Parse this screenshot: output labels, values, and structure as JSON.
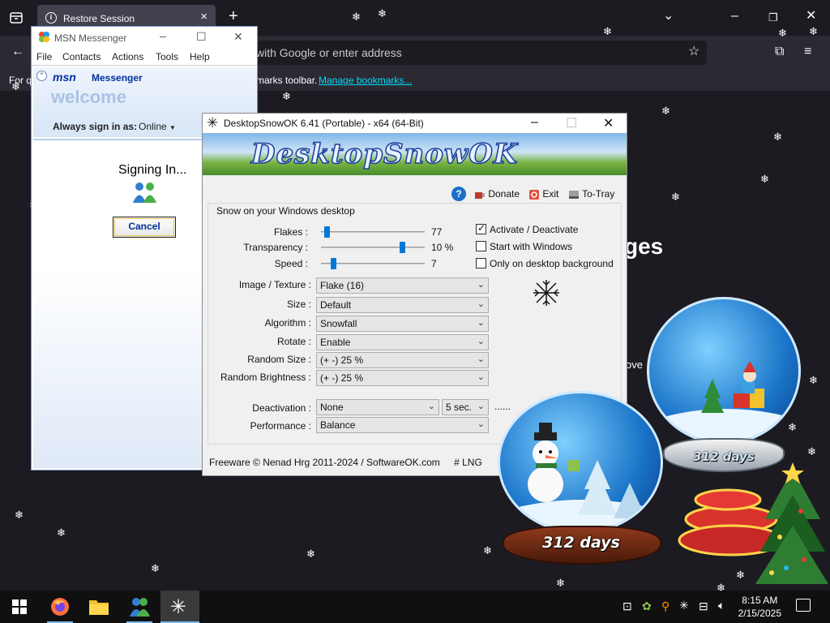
{
  "firefox": {
    "tab_title": "Restore Session",
    "url_placeholder": "with Google or enter address",
    "bookmark_prefix": "For q",
    "bookmark_text": "marks toolbar.",
    "bookmark_link": "Manage bookmarks...",
    "partial_heading": "ges",
    "partial_text": "ove"
  },
  "msn": {
    "title": "MSN Messenger",
    "menu": [
      "File",
      "Contacts",
      "Actions",
      "Tools",
      "Help"
    ],
    "brand_msn": "msn",
    "brand_messenger": "Messenger",
    "welcome": "welcome",
    "signin_label": "Always sign in as:",
    "signin_status": "Online",
    "signing_in": "Signing In...",
    "cancel": "Cancel"
  },
  "dso": {
    "title": "DesktopSnowOK 6.41 (Portable) - x64 (64-Bit)",
    "banner": "DesktopSnowOK",
    "toolbar": {
      "help": "?",
      "donate": "Donate",
      "exit": "Exit",
      "tray": "To-Tray"
    },
    "group_label": "Snow on your Windows desktop",
    "sliders": [
      {
        "label": "Flakes :",
        "value": "77",
        "level": 0.03
      },
      {
        "label": "Transparency :",
        "value": "10 %",
        "level": 0.8
      },
      {
        "label": "Speed :",
        "value": "7",
        "level": 0.1
      }
    ],
    "checkboxes": [
      {
        "label": "Activate / Deactivate",
        "checked": true
      },
      {
        "label": "Start with Windows",
        "checked": false
      },
      {
        "label": "Only on desktop background",
        "checked": false
      }
    ],
    "dropdowns": [
      {
        "label": "Image / Texture :",
        "value": "Flake (16)"
      },
      {
        "label": "Size :",
        "value": "Default"
      },
      {
        "label": "Algorithm :",
        "value": "Snowfall"
      },
      {
        "label": "Rotate :",
        "value": "Enable"
      },
      {
        "label": "Random Size :",
        "value": "(+ -) 25 %"
      },
      {
        "label": "Random Brightness :",
        "value": "(+ -) 25 %"
      }
    ],
    "deactivation": {
      "label": "Deactivation :",
      "value": "None",
      "time": "5 sec.",
      "more": "......"
    },
    "performance": {
      "label": "Performance :",
      "value": "Balance"
    },
    "footer_copyright": "Freeware © Nenad Hrg 2011-2024 / SoftwareOK.com",
    "footer_lng": "# LNG"
  },
  "globes": {
    "front_days": "312 days",
    "back_days": "312 days"
  },
  "taskbar": {
    "apps": [
      "start-icon",
      "firefox-icon",
      "file-explorer-icon",
      "msn-messenger-icon",
      "desktopsnowok-icon"
    ],
    "time": "8:15 AM",
    "date": "2/15/2025"
  },
  "colors": {
    "accent": "#0078d7",
    "firefox_bg": "#1c1b22",
    "msn_blue": "#00309c",
    "link": "#00ddff"
  }
}
